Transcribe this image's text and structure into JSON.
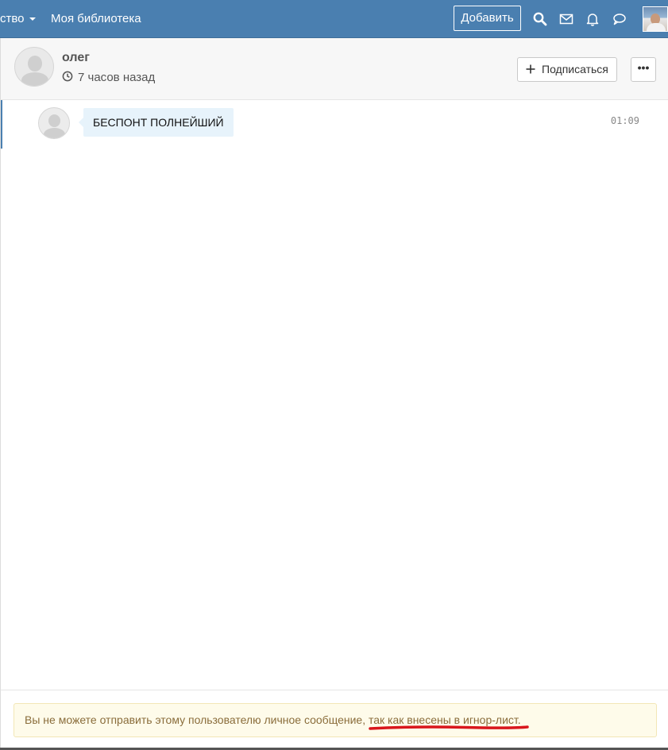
{
  "nav": {
    "community_label": "ство",
    "library_label": "Моя библиотека",
    "add_label": "Добавить",
    "icons": [
      "search-icon",
      "envelope-icon",
      "bell-icon",
      "chat-bubble-icon"
    ]
  },
  "conversation": {
    "name": "олег",
    "time_ago": "7 часов назад",
    "subscribe_label": "Подписаться",
    "more_label": "•••"
  },
  "messages": [
    {
      "text": "БЕСПОНТ ПОЛНЕЙШИЙ",
      "time": "01:09"
    }
  ],
  "notice": {
    "text": "Вы не можете отправить этому пользователю личное сообщение, так как внесены в игнор-лист."
  },
  "colors": {
    "topbar": "#4a7fb0",
    "notice_bg": "#fefbea",
    "notice_text": "#8a6d3b",
    "bubble_bg": "#e7f3fb",
    "underline": "#d9161c"
  }
}
